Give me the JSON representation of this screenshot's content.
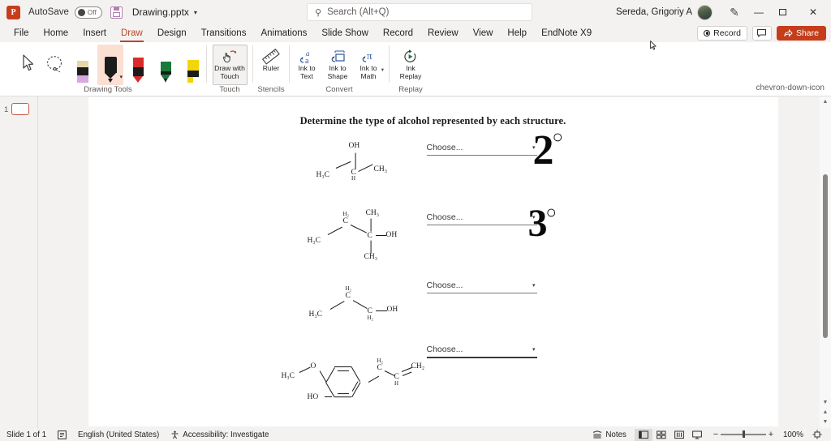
{
  "titlebar": {
    "app_icon": "powerpoint-icon",
    "app_letter": "P",
    "autosave_label": "AutoSave",
    "autosave_state": "Off",
    "save_icon": "save-icon",
    "filename": "Drawing.pptx",
    "filename_caret": "▾",
    "user_name": "Sereda, Grigoriy A",
    "minimize": "—",
    "restore": "❐",
    "close": "✕"
  },
  "search": {
    "icon": "search-icon",
    "placeholder": "Search (Alt+Q)"
  },
  "ribbon": {
    "tabs": [
      {
        "label": "File",
        "active": false
      },
      {
        "label": "Home",
        "active": false
      },
      {
        "label": "Insert",
        "active": false
      },
      {
        "label": "Draw",
        "active": true
      },
      {
        "label": "Design",
        "active": false
      },
      {
        "label": "Transitions",
        "active": false
      },
      {
        "label": "Animations",
        "active": false
      },
      {
        "label": "Slide Show",
        "active": false
      },
      {
        "label": "Record",
        "active": false
      },
      {
        "label": "Review",
        "active": false
      },
      {
        "label": "View",
        "active": false
      },
      {
        "label": "Help",
        "active": false
      },
      {
        "label": "EndNote X9",
        "active": false
      }
    ],
    "record_button": "Record",
    "comment_icon": "comment-icon",
    "share_button": "Share",
    "collapse_icon": "chevron-down-icon",
    "groups": [
      {
        "label": "Drawing Tools"
      },
      {
        "label": "Touch"
      },
      {
        "label": "Stencils"
      },
      {
        "label": "Convert"
      },
      {
        "label": "Replay"
      }
    ],
    "tools": [
      {
        "name": "select-tool",
        "selected": false
      },
      {
        "name": "lasso-select-tool",
        "selected": false
      },
      {
        "name": "eraser-tool",
        "selected": false
      },
      {
        "name": "black-pen-tool",
        "selected": true
      },
      {
        "name": "red-pen-tool",
        "selected": false
      },
      {
        "name": "green-pencil-tool",
        "selected": false
      },
      {
        "name": "yellow-highlighter-tool",
        "selected": false
      }
    ],
    "draw_with_touch": "Draw with Touch",
    "ruler": "Ruler",
    "ink_to_text": "Ink to Text",
    "ink_to_shape": "Ink to Shape",
    "ink_to_math": "Ink to Math",
    "ink_replay": "Ink Replay"
  },
  "thumbnail_panel": {
    "slide_number": "1"
  },
  "slide": {
    "title": "Determine the type of alcohol represented by each structure.",
    "structures": [
      {
        "name": "isopropanol",
        "labels": [
          "OH",
          "H₃C",
          "H",
          "CH₃"
        ]
      },
      {
        "name": "2-methyl-2-butanol",
        "labels": [
          "H₂",
          "CH₃",
          "H₃C",
          "C",
          "C",
          "OH",
          "CH₃"
        ]
      },
      {
        "name": "1-propanol",
        "labels": [
          "H₂",
          "C",
          "H₃C",
          "C",
          "H₂",
          "OH"
        ]
      },
      {
        "name": "eugenol",
        "labels": [
          "H₃C",
          "O",
          "HO",
          "H₂",
          "C",
          "CH",
          "CH₂"
        ]
      }
    ],
    "dropdowns": [
      {
        "label": "Choose...",
        "caret": "▾",
        "focused": false
      },
      {
        "label": "Choose...",
        "caret": "▾",
        "focused": false
      },
      {
        "label": "Choose...",
        "caret": "▾",
        "focused": false
      },
      {
        "label": "Choose...",
        "caret": "▾",
        "focused": true
      }
    ],
    "ink_annotations": [
      {
        "text": "2",
        "degree": "○"
      },
      {
        "text": "3",
        "degree": "○"
      }
    ]
  },
  "statusbar": {
    "slide_count": "Slide 1 of 1",
    "notes_icon": "notes-icon",
    "language": "English (United States)",
    "accessibility": "Accessibility: Investigate",
    "notes_label": "Notes",
    "views": [
      {
        "name": "normal-view-button",
        "icon": "▤",
        "active": true
      },
      {
        "name": "slide-sorter-button",
        "icon": "☷",
        "active": false
      },
      {
        "name": "reading-view-button",
        "icon": "▥",
        "active": false
      },
      {
        "name": "slideshow-button",
        "icon": "□",
        "active": false
      }
    ],
    "zoom_out": "−",
    "zoom_in": "+",
    "zoom_level": "100%",
    "fit_slide_icon": "fit-to-window-icon"
  },
  "scrollbar": {
    "up_arrow": "▲",
    "down_arrow": "▼",
    "prev_slide": "▲",
    "next_slide": "▼"
  }
}
